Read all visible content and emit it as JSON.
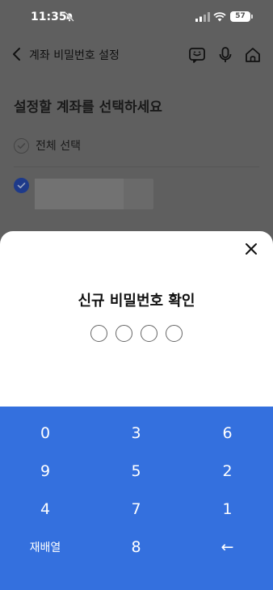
{
  "status_bar": {
    "time": "11:35",
    "battery": "57"
  },
  "header": {
    "title": "계좌 비밀번호 설정"
  },
  "page": {
    "heading": "설정할 계좌를 선택하세요",
    "select_all_label": "전체 선택"
  },
  "sheet": {
    "title": "신규 비밀번호 확인",
    "pin_length": 4
  },
  "keypad": {
    "keys": [
      "0",
      "3",
      "6",
      "9",
      "5",
      "2",
      "4",
      "7",
      "1",
      "재배열",
      "8",
      "←"
    ]
  },
  "colors": {
    "keypad_bg": "#3470de",
    "overlay": "#5f5f5f",
    "selected_check": "#1e3a8a"
  }
}
